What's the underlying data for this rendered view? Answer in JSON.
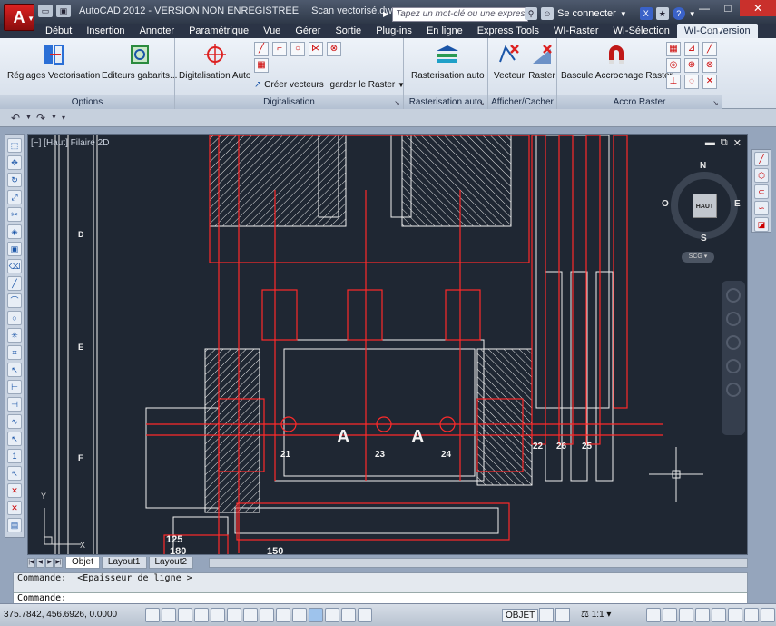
{
  "titlebar": {
    "app_version": "AutoCAD 2012 - VERSION NON ENREGISTREE",
    "document": "Scan vectorisé.dwg",
    "search_placeholder": "Tapez un mot-clé ou une expression",
    "signin": "Se connecter"
  },
  "tabs": [
    {
      "label": "Début"
    },
    {
      "label": "Insertion"
    },
    {
      "label": "Annoter"
    },
    {
      "label": "Paramétrique"
    },
    {
      "label": "Vue"
    },
    {
      "label": "Gérer"
    },
    {
      "label": "Sortie"
    },
    {
      "label": "Plug-ins"
    },
    {
      "label": "En ligne"
    },
    {
      "label": "Express Tools"
    },
    {
      "label": "WI-Raster"
    },
    {
      "label": "WI-Sélection"
    },
    {
      "label": "WI-Conversion"
    }
  ],
  "active_tab": "WI-Conversion",
  "ribbon": {
    "options": {
      "title": "Options",
      "reglages": "Réglages Vectorisation",
      "editeurs": "Editeurs gabarits..."
    },
    "digitalisation": {
      "title": "Digitalisation",
      "auto": "Digitalisation Auto",
      "creer": "Créer vecteurs",
      "garder": "garder le Raster"
    },
    "rasterisation": {
      "title": "Rasterisation auto",
      "btn": "Rasterisation auto"
    },
    "afficher": {
      "title": "Afficher/Cacher",
      "vecteur": "Vecteur",
      "raster": "Raster"
    },
    "accro": {
      "title": "Accro Raster",
      "bascule": "Bascule Accrochage Raster"
    }
  },
  "viewport": {
    "label": "[−] [Haut] Filaire 2D",
    "viewcube_face": "HAUT",
    "compass": {
      "n": "N",
      "s": "S",
      "e": "E",
      "w": "O"
    },
    "ucs": "SCG",
    "row_labels": [
      "D",
      "E",
      "F"
    ],
    "dimensions": [
      "125",
      "180",
      "150"
    ],
    "part_labels": [
      "21",
      "23",
      "24",
      "22",
      "26",
      "25",
      "A",
      "A"
    ],
    "axis_y": "Y",
    "axis_x": "X"
  },
  "layout_tabs": [
    "Objet",
    "Layout1",
    "Layout2"
  ],
  "command": {
    "history": "Commande:  <Epaisseur de ligne >",
    "prompt": "Commande:"
  },
  "status": {
    "coords": "375.7842, 456.6926, 0.0000",
    "space": "OBJET",
    "scale": "1:1"
  },
  "colors": {
    "drawing_bg": "#1f2733",
    "raster_lines": "#ffffff",
    "vector_lines": "#ff2020",
    "title_bg": "#2e3848",
    "ribbon_bg": "#dfe6ef"
  }
}
